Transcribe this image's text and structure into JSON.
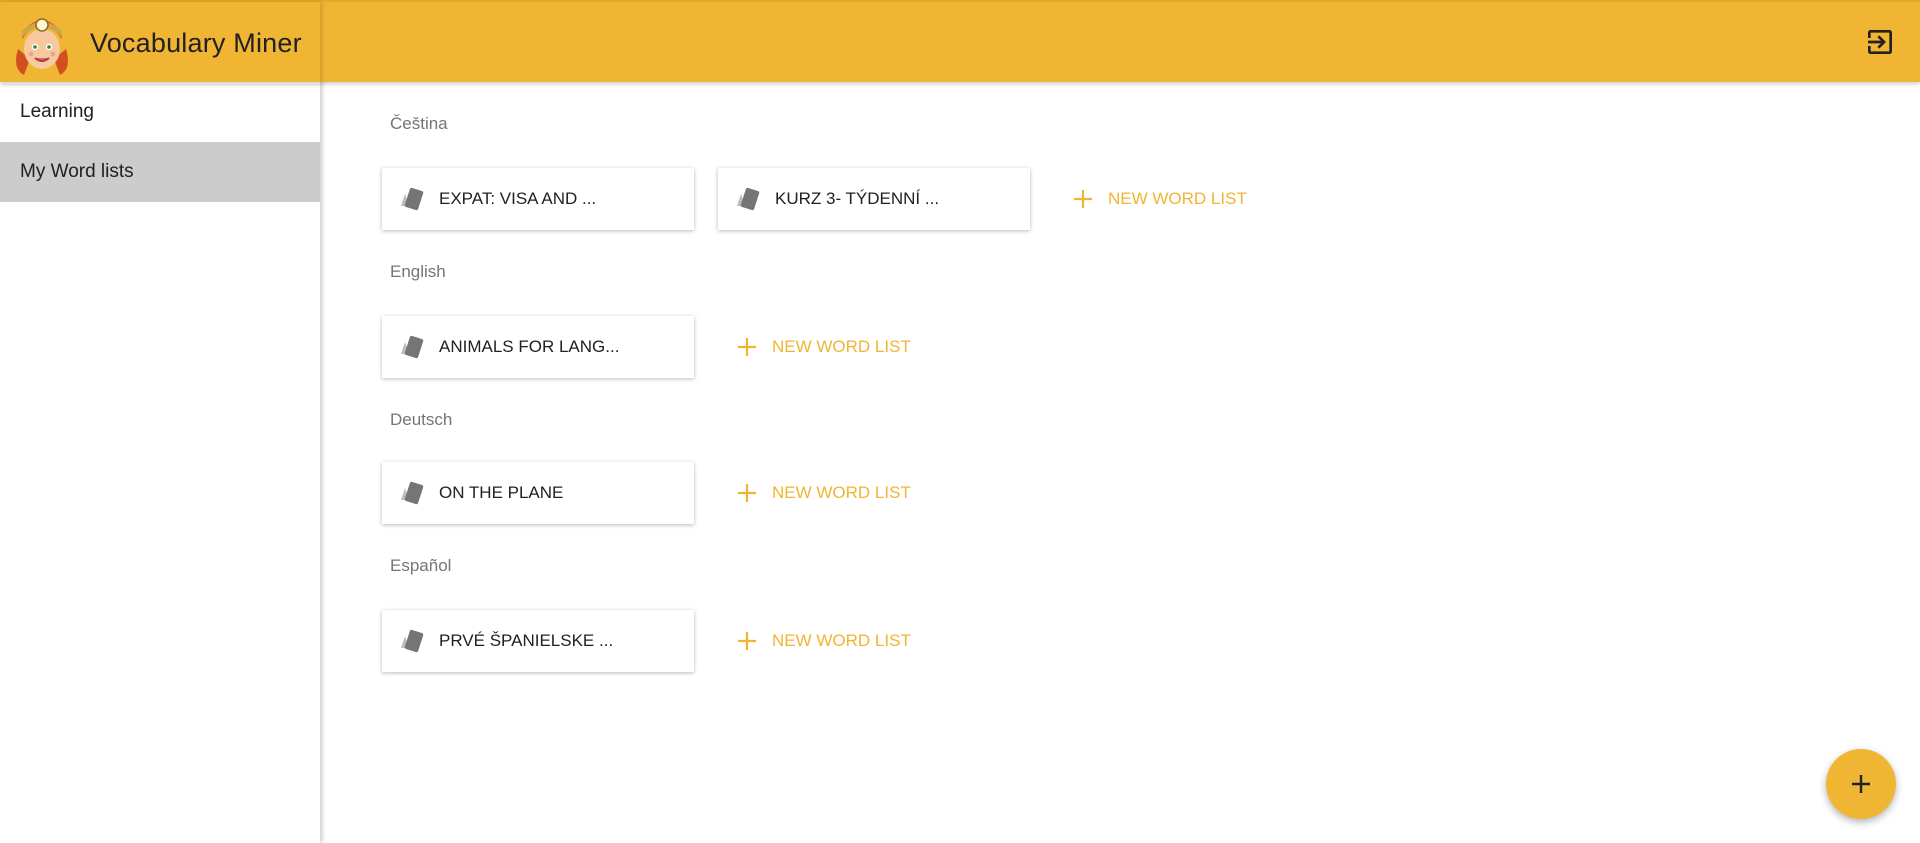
{
  "app": {
    "title": "Vocabulary Miner",
    "accent_color": "#F0B532"
  },
  "header": {
    "logout_icon": "logout-icon"
  },
  "sidebar": {
    "items": [
      {
        "label": "Learning",
        "active": false
      },
      {
        "label": "My Word lists",
        "active": true
      }
    ]
  },
  "sections": [
    {
      "language": "Čeština",
      "lists": [
        "EXPAT: VISA AND ...",
        "KURZ 3- TÝDENNÍ ..."
      ],
      "new_label": "NEW WORD LIST"
    },
    {
      "language": "English",
      "lists": [
        "ANIMALS FOR LANG..."
      ],
      "new_label": "NEW WORD LIST"
    },
    {
      "language": "Deutsch",
      "lists": [
        "ON THE PLANE"
      ],
      "new_label": "NEW WORD LIST"
    },
    {
      "language": "Español",
      "lists": [
        "PRVÉ ŠPANIELSKE ..."
      ],
      "new_label": "NEW WORD LIST"
    }
  ],
  "fab": {
    "icon": "plus-icon"
  }
}
